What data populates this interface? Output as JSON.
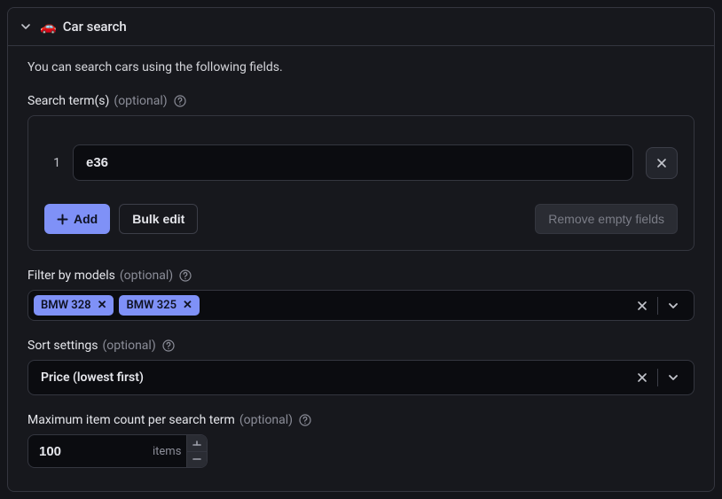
{
  "panel": {
    "icon": "🚗",
    "title": "Car search"
  },
  "description": "You can search cars using the following fields.",
  "searchTerms": {
    "label": "Search term(s)",
    "optional": "(optional)",
    "items": [
      {
        "index": "1",
        "value": "e36"
      }
    ],
    "addLabel": "Add",
    "bulkEditLabel": "Bulk edit",
    "removeEmptyLabel": "Remove empty fields"
  },
  "models": {
    "label": "Filter by models",
    "optional": "(optional)",
    "chips": [
      "BMW 328",
      "BMW 325"
    ]
  },
  "sort": {
    "label": "Sort settings",
    "optional": "(optional)",
    "value": "Price (lowest first)"
  },
  "maxItems": {
    "label": "Maximum item count per search term",
    "optional": "(optional)",
    "value": "100",
    "suffix": "items"
  }
}
